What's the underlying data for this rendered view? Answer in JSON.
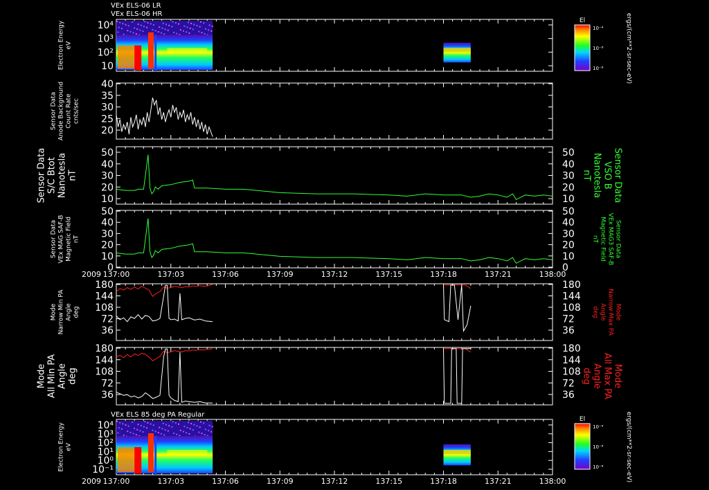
{
  "header": {
    "line1": "VEx ELS-06 LR",
    "line2": "VEx ELS-06 HR",
    "bottom_title": "VEx ELS 85 deg PA Regular",
    "year": "2009"
  },
  "colors": {
    "background": "#000000",
    "axis": "#ffffff",
    "green": "#33ff33",
    "red": "#ff2020",
    "white": "#ffffff"
  },
  "time_axis": {
    "ticks": [
      "137:00",
      "137:03",
      "137:06",
      "137:09",
      "137:12",
      "137:15",
      "137:18",
      "137:21",
      "138:00"
    ],
    "label_panels": [
      "p4",
      "p7"
    ]
  },
  "colorbars": [
    {
      "panel": "p1",
      "title": "El",
      "ticks": [
        "10⁻⁴",
        "10⁻⁸",
        "10⁻⁸"
      ],
      "unit": "ergs/(cm**2-sr-sec-eV)"
    },
    {
      "panel": "p7",
      "title": "El",
      "ticks": [
        "10⁻⁴",
        "10⁻⁸",
        "10⁻⁸"
      ],
      "unit": "ergs/(cm**2-sr-sec-eV)"
    }
  ],
  "panels": [
    {
      "id": "p1",
      "left_label": [
        "Electron Energy",
        "eV"
      ],
      "right_label": [],
      "yticks": [
        "10⁴",
        "10³",
        "10²",
        "10"
      ]
    },
    {
      "id": "p2",
      "left_label": [
        "Sensor Data",
        "Anode Background",
        "Count Rate",
        "cnts/sec"
      ],
      "right_label": [],
      "yticks": [
        "40",
        "35",
        "30",
        "25",
        "20"
      ]
    },
    {
      "id": "p3",
      "left_label": [
        "Sensor Data",
        "S/C Btot",
        "Nanotesla",
        "nT"
      ],
      "right_label": [
        "Sensor Data",
        "VSO B",
        "Nanotesla",
        "nT"
      ],
      "yticks": [
        "50",
        "40",
        "30",
        "20",
        "10"
      ]
    },
    {
      "id": "p4",
      "left_label": [
        "Sensor Data",
        "VEx MAG SAF-B",
        "Magnetic Field",
        "nT"
      ],
      "right_label": [
        "Sensor Data",
        "VEx MAG3 SAF-B",
        "Magnetic Field",
        "nT"
      ],
      "yticks": [
        "50",
        "40",
        "30",
        "20",
        "10",
        "0"
      ]
    },
    {
      "id": "p5",
      "left_label": [
        "Mode",
        "Narrow Min PA",
        "Angle",
        "deg"
      ],
      "right_label": [
        "Mode",
        "Narrow Max PA",
        "Angle",
        "deg"
      ],
      "yticks": [
        "180",
        "144",
        "108",
        "72",
        "36"
      ]
    },
    {
      "id": "p6",
      "left_label": [
        "Mode",
        "All Min PA",
        "Angle",
        "deg"
      ],
      "right_label": [
        "Mode",
        "All Max PA",
        "Angle",
        "deg"
      ],
      "yticks": [
        "180",
        "144",
        "108",
        "72",
        "36"
      ]
    },
    {
      "id": "p7",
      "left_label": [
        "Electron Energy",
        "eV"
      ],
      "right_label": [],
      "yticks": [
        "10⁴",
        "10³",
        "10²",
        "10¹",
        "10⁰",
        "10⁻¹"
      ]
    }
  ],
  "chart_data": [
    {
      "type": "heatmap",
      "panel": "p1",
      "y_scale": "log",
      "blocks": [
        {
          "t0": 0,
          "t1": 5.3,
          "note": "spectrogram"
        },
        {
          "t0": 18.0,
          "t1": 19.5,
          "note": "spectrogram"
        }
      ]
    },
    {
      "type": "line",
      "panel": "p2",
      "ylim": [
        17,
        40
      ],
      "series": [
        {
          "color": "#ffffff",
          "x": [
            0,
            0.1,
            0.2,
            0.3,
            0.4,
            0.5,
            0.6,
            0.7,
            0.8,
            0.9,
            1.0,
            1.1,
            1.2,
            1.3,
            1.4,
            1.5,
            1.6,
            1.7,
            1.8,
            1.9,
            2.0,
            2.1,
            2.2,
            2.3,
            2.4,
            2.5,
            2.6,
            2.7,
            2.8,
            2.9,
            3.0,
            3.1,
            3.2,
            3.3,
            3.4,
            3.5,
            3.6,
            3.7,
            3.8,
            3.9,
            4.0,
            4.1,
            4.2,
            4.3,
            4.4,
            4.5,
            4.6,
            4.7,
            4.8,
            4.9,
            5.0,
            5.1,
            5.2,
            5.3
          ],
          "y": [
            27,
            22,
            25,
            20,
            23,
            21,
            24,
            19,
            26,
            22,
            24,
            27,
            21,
            25,
            23,
            26,
            22,
            28,
            24,
            29,
            34,
            31,
            33,
            27,
            30,
            25,
            28,
            24,
            27,
            29,
            26,
            31,
            28,
            30,
            25,
            28,
            26,
            29,
            24,
            27,
            25,
            28,
            23,
            26,
            22,
            25,
            21,
            24,
            20,
            23,
            19,
            22,
            20,
            18
          ]
        }
      ]
    },
    {
      "type": "line",
      "panel": "p3",
      "ylim": [
        0,
        50
      ],
      "series": [
        {
          "color": "#33ff33",
          "x": [
            0,
            0.5,
            1.0,
            1.2,
            1.5,
            1.6,
            1.75,
            1.85,
            1.95,
            2.05,
            2.15,
            2.3,
            2.5,
            3.0,
            3.5,
            4.0,
            4.2,
            4.3,
            5.0,
            6.0,
            7.0,
            9.0,
            11.0,
            13.0,
            15.0,
            16.0,
            17.0,
            18.0,
            19.0,
            19.5,
            20.0,
            20.5,
            21.0,
            21.5,
            21.8,
            22.0,
            22.5,
            23.0,
            23.5,
            24.0
          ],
          "y": [
            13,
            12,
            12,
            13,
            13,
            25,
            43,
            14,
            9,
            11,
            15,
            13,
            16,
            17,
            19,
            20,
            21,
            14,
            14,
            13,
            13,
            10,
            9,
            9,
            8,
            7,
            9,
            8,
            8,
            6,
            7,
            9,
            8,
            6,
            9,
            4,
            8,
            7,
            8,
            7
          ]
        }
      ]
    },
    {
      "type": "line",
      "panel": "p4",
      "ylim": [
        0,
        50
      ],
      "series": [
        {
          "color": "#33ff33",
          "x": [
            0,
            0.5,
            1.0,
            1.2,
            1.5,
            1.6,
            1.75,
            1.85,
            1.95,
            2.05,
            2.15,
            2.3,
            2.5,
            3.0,
            3.5,
            4.0,
            4.2,
            4.3,
            5.0,
            6.0,
            7.0,
            9.0,
            11.0,
            13.0,
            15.0,
            16.0,
            17.0,
            18.0,
            19.0,
            19.5,
            20.0,
            20.5,
            21.0,
            21.5,
            21.8,
            22.0,
            22.5,
            23.0,
            23.5,
            24.0
          ],
          "y": [
            13,
            12,
            12,
            13,
            13,
            25,
            43,
            14,
            9,
            11,
            15,
            13,
            16,
            17,
            19,
            20,
            21,
            14,
            14,
            13,
            13,
            10,
            9,
            9,
            8,
            7,
            9,
            8,
            8,
            6,
            7,
            9,
            8,
            6,
            9,
            4,
            8,
            7,
            8,
            7
          ]
        }
      ]
    },
    {
      "type": "line",
      "panel": "p5",
      "ylim": [
        0,
        180
      ],
      "series": [
        {
          "color": "#ff2020",
          "x": [
            0,
            0.2,
            0.4,
            0.6,
            0.8,
            1.0,
            1.2,
            1.4,
            1.6,
            1.8,
            2.0,
            2.2,
            2.4,
            2.6,
            2.8,
            3.0,
            3.2,
            3.4,
            3.6,
            3.8,
            4.0,
            4.2,
            4.4,
            4.6,
            4.8,
            5.0,
            5.3
          ],
          "y": [
            155,
            165,
            160,
            168,
            162,
            170,
            163,
            172,
            166,
            160,
            140,
            150,
            155,
            170,
            166,
            168,
            172,
            170,
            168,
            171,
            170,
            173,
            172,
            174,
            172,
            173,
            178
          ]
        },
        {
          "color": "#ffffff",
          "x": [
            0,
            0.2,
            0.4,
            0.6,
            0.8,
            1.0,
            1.2,
            1.4,
            1.6,
            1.8,
            2.0,
            2.2,
            2.4,
            2.6,
            2.7,
            2.8,
            2.9,
            3.0,
            3.2,
            3.4,
            3.5,
            3.6,
            3.8,
            4.0,
            4.3,
            4.6,
            4.9,
            5.3
          ],
          "y": [
            78,
            66,
            72,
            60,
            75,
            70,
            82,
            68,
            80,
            76,
            62,
            64,
            70,
            140,
            175,
            175,
            70,
            66,
            68,
            62,
            150,
            66,
            70,
            72,
            65,
            68,
            62,
            60
          ]
        },
        {
          "color": "#ff2020",
          "x": [
            18.0,
            18.2,
            18.5,
            18.8,
            19.0,
            19.2,
            19.5
          ],
          "y": [
            176,
            176,
            176,
            176,
            176,
            176,
            165
          ]
        },
        {
          "color": "#ffffff",
          "x": [
            18.0,
            18.05,
            18.3,
            18.4,
            18.6,
            18.8,
            19.0,
            19.1,
            19.3,
            19.5
          ],
          "y": [
            176,
            66,
            60,
            176,
            176,
            66,
            176,
            30,
            50,
            110
          ]
        }
      ]
    },
    {
      "type": "line",
      "panel": "p6",
      "ylim": [
        0,
        180
      ],
      "series": [
        {
          "color": "#ff2020",
          "x": [
            0,
            0.2,
            0.4,
            0.6,
            0.8,
            1.0,
            1.2,
            1.4,
            1.6,
            1.8,
            2.0,
            2.2,
            2.4,
            2.6,
            2.8,
            3.0,
            3.2,
            3.4,
            3.6,
            3.8,
            4.0,
            4.2,
            4.4,
            4.6,
            4.8,
            5.0,
            5.3
          ],
          "y": [
            150,
            155,
            148,
            158,
            150,
            160,
            155,
            162,
            158,
            150,
            138,
            145,
            152,
            168,
            164,
            166,
            170,
            168,
            166,
            170,
            169,
            172,
            171,
            173,
            172,
            174,
            176
          ]
        },
        {
          "color": "#ffffff",
          "x": [
            0,
            0.2,
            0.4,
            0.6,
            0.8,
            1.0,
            1.2,
            1.4,
            1.6,
            1.8,
            2.0,
            2.2,
            2.4,
            2.6,
            2.7,
            2.8,
            2.9,
            3.0,
            3.2,
            3.4,
            3.5,
            3.6,
            3.8,
            4.0,
            4.3,
            4.6,
            4.9,
            5.3
          ],
          "y": [
            40,
            35,
            30,
            32,
            25,
            28,
            22,
            26,
            38,
            30,
            20,
            24,
            30,
            150,
            175,
            175,
            30,
            22,
            14,
            10,
            165,
            8,
            12,
            10,
            8,
            10,
            6,
            6
          ]
        },
        {
          "color": "#ff2020",
          "x": [
            18.0,
            18.2,
            18.5,
            18.8,
            19.0,
            19.2,
            19.5
          ],
          "y": [
            176,
            176,
            176,
            176,
            176,
            176,
            165
          ]
        },
        {
          "color": "#ffffff",
          "x": [
            18.0,
            18.05,
            18.4,
            18.45,
            18.7,
            18.75,
            19.0,
            19.05,
            19.5
          ],
          "y": [
            176,
            5,
            5,
            176,
            176,
            5,
            5,
            176,
            176
          ]
        }
      ]
    },
    {
      "type": "heatmap",
      "panel": "p7",
      "y_scale": "log",
      "blocks": [
        {
          "t0": 0,
          "t1": 5.3,
          "note": "spectrogram"
        },
        {
          "t0": 18.0,
          "t1": 19.5,
          "note": "spectrogram"
        }
      ]
    }
  ]
}
